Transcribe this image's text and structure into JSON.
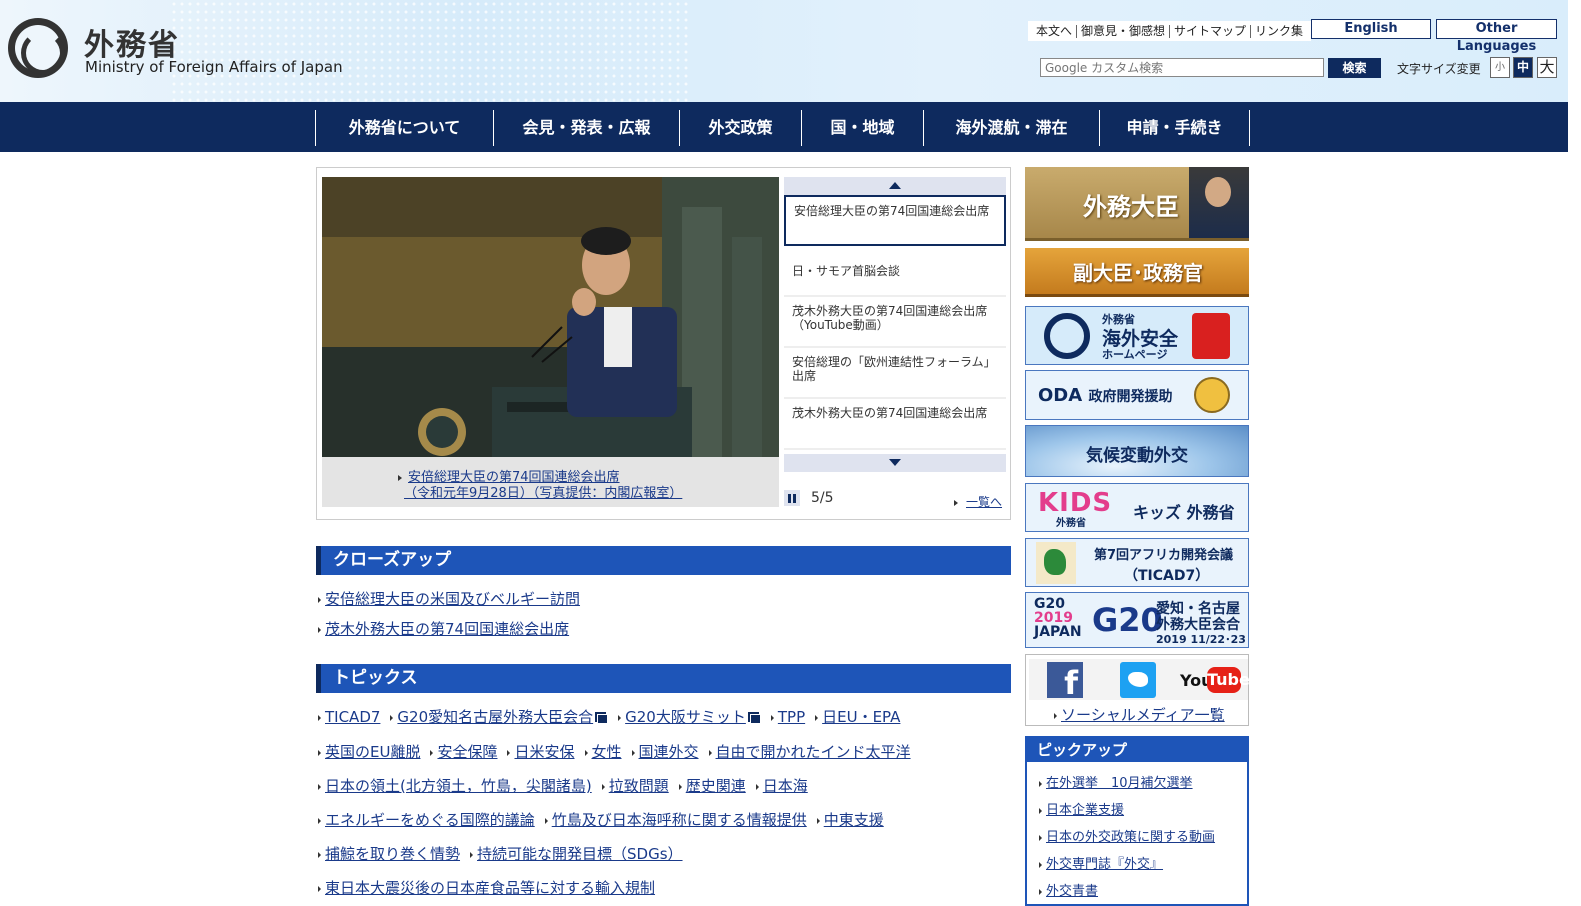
{
  "header": {
    "logo_jp": "外務省",
    "logo_en": "Ministry of Foreign Affairs of Japan",
    "util_links": [
      "本文へ",
      "御意見・御感想",
      "サイトマップ",
      "リンク集"
    ],
    "english_label": "English",
    "other_lang_label": "Other Languages",
    "search_placeholder": "Google カスタム検索",
    "search_button": "検索",
    "fontsize_label": "文字サイズ変更",
    "fontsize_small": "小",
    "fontsize_mid": "中",
    "fontsize_large": "大"
  },
  "nav": [
    "外務省について",
    "会見・発表・広報",
    "外交政策",
    "国・地域",
    "海外渡航・滞在",
    "申請・手続き"
  ],
  "slider": {
    "caption_line1": "安倍総理大臣の第74回国連総会出席",
    "caption_line2": "（令和元年9月28日）（写真提供：内閣広報室）",
    "items": [
      "安倍総理大臣の第74回国連総会出席",
      "日・サモア首脳会談",
      "茂木外務大臣の第74回国連総会出席（YouTube動画）",
      "安倍総理の「欧州連結性フォーラム」出席",
      "茂木外務大臣の第74回国連総会出席"
    ],
    "counter": "5/5",
    "list_link": "一覧へ"
  },
  "closeup": {
    "heading": "クローズアップ",
    "items": [
      "安倍総理大臣の米国及びベルギー訪問",
      "茂木外務大臣の第74回国連総会出席"
    ]
  },
  "topics": {
    "heading": "トピックス",
    "rows": [
      [
        "TICAD7",
        "G20愛知名古屋外務大臣会合",
        "G20大阪サミット",
        "TPP",
        "日EU・EPA"
      ],
      [
        "英国のEU離脱",
        "安全保障",
        "日米安保",
        "女性",
        "国連外交",
        "自由で開かれたインド太平洋"
      ],
      [
        "日本の領土(北方領土，竹島，尖閣諸島)",
        "拉致問題",
        "歴史関連",
        "日本海"
      ],
      [
        "エネルギーをめぐる国際的議論",
        "竹島及び日本海呼称に関する情報提供",
        "中東支援"
      ],
      [
        "捕鯨を取り巻く情勢",
        "持続可能な開発目標（SDGs）"
      ],
      [
        "東日本大震災後の日本産食品等に対する輸入規制"
      ]
    ]
  },
  "sidebar": {
    "minister": "外務大臣",
    "vice": "副大臣･政務官",
    "safety_1": "外務省",
    "safety_2": "海外安全",
    "safety_3": "ホームページ",
    "oda": "ODA",
    "oda_sub": "政府開発援助",
    "climate": "気候変動外交",
    "kids_logo": "KIDS",
    "kids_logo_sub": "外務省",
    "kids": "キッズ 外務省",
    "ticad_1": "第7回アフリカ開発会議",
    "ticad_2": "（TICAD7）",
    "g20_logo_1": "G20",
    "g20_logo_2": "2019",
    "g20_logo_3": "JAPAN",
    "g20_big": "G20",
    "g20_1": "愛知・名古屋",
    "g20_2": "外務大臣会合",
    "g20_3": "2019 11/22･23",
    "social_fb": "f",
    "social_yt_1": "You",
    "social_yt_2": "Tube",
    "social_link": "ソーシャルメディア一覧",
    "pickup_heading": "ピックアップ",
    "pickup_items": [
      "在外選挙　10月補欠選挙",
      "日本企業支援",
      "日本の外交政策に関する動画",
      "外交専門誌『外交』",
      "外交青書"
    ]
  },
  "icons": [
    "logo-emblem-icon",
    "pause-icon",
    "arrow-up-icon",
    "arrow-down-icon",
    "external-link-icon",
    "facebook-icon",
    "twitter-icon",
    "youtube-icon"
  ],
  "colors": {
    "navy": "#0e2a5e",
    "section_blue": "#1e55b8",
    "link": "#1a3a8a"
  }
}
